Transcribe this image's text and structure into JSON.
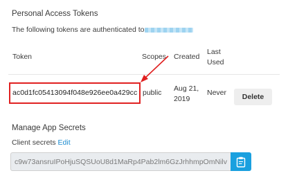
{
  "tokens_section": {
    "title": "Personal Access Tokens",
    "description": "The following tokens are authenticated to"
  },
  "table": {
    "headers": {
      "token": "Token",
      "scopes": "Scopes",
      "created": "Created",
      "last_used": [
        "Last",
        "Used"
      ]
    },
    "rows": [
      {
        "token": "ac0d1fc05413094f048e926ee0a429cc",
        "scopes": "public",
        "created": [
          "Aug 21,",
          "2019"
        ],
        "last_used": "Never",
        "action": "Delete"
      }
    ]
  },
  "secrets_section": {
    "title": "Manage App Secrets",
    "client_secrets_label": "Client secrets",
    "edit_link": "Edit",
    "secret_value": "c9w73ansruIPoHjuSQSUoU8d1MaRp4Pab2lm6GzJrhhmpOmNilv",
    "copy_icon": "clipboard-copy-icon"
  },
  "colors": {
    "highlight": "#e02020",
    "accent": "#1aa0df",
    "link": "#1a8bd0"
  }
}
